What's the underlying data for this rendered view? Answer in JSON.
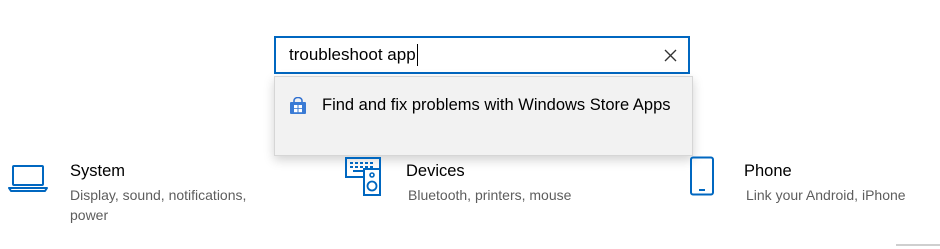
{
  "search": {
    "value": "troubleshoot app",
    "clear_icon": "close-icon"
  },
  "suggestions": [
    {
      "icon": "store-icon",
      "label": "Find and fix problems with Windows Store Apps"
    }
  ],
  "categories": [
    {
      "icon": "laptop-icon",
      "title": "System",
      "description": "Display, sound, notifications, power"
    },
    {
      "icon": "keyboard-speaker-icon",
      "title": "Devices",
      "description": "Bluetooth, printers, mouse"
    },
    {
      "icon": "phone-icon",
      "title": "Phone",
      "description": "Link your Android, iPhone"
    }
  ],
  "colors": {
    "accent": "#0067c0",
    "store_blue": "#3a7bd5"
  }
}
